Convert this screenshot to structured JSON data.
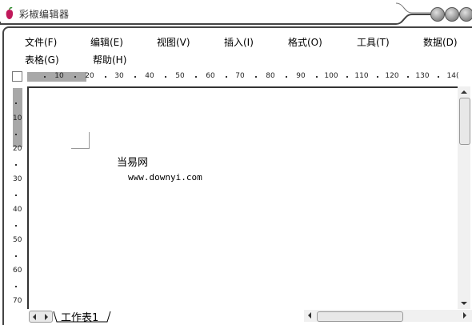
{
  "window": {
    "title": "彩椒编辑器",
    "brand_color": "#c0185a"
  },
  "menu": {
    "row1": [
      "文件(F)",
      "编辑(E)",
      "视图(V)",
      "插入(I)",
      "格式(O)",
      "工具(T)",
      "数据(D)"
    ],
    "row2": [
      "表格(G)",
      "帮助(H)"
    ]
  },
  "hruler": {
    "labels": [
      "10",
      "20",
      "30",
      "40",
      "50",
      "60",
      "70",
      "80",
      "90",
      "100",
      "110",
      "120",
      "130",
      "14("
    ]
  },
  "vruler": {
    "labels": [
      "10",
      "20",
      "30",
      "40",
      "50",
      "60",
      "70"
    ]
  },
  "document": {
    "line1": "当易网",
    "line2": "www.downyi.com"
  },
  "sheets": {
    "active_tab": "工作表1"
  },
  "icons": {
    "app": "pepper-icon",
    "window_buttons": [
      "minimize-icon",
      "maximize-icon",
      "close-icon"
    ],
    "scroll": [
      "arrow-up-icon",
      "arrow-down-icon",
      "arrow-left-icon",
      "arrow-right-icon"
    ]
  }
}
